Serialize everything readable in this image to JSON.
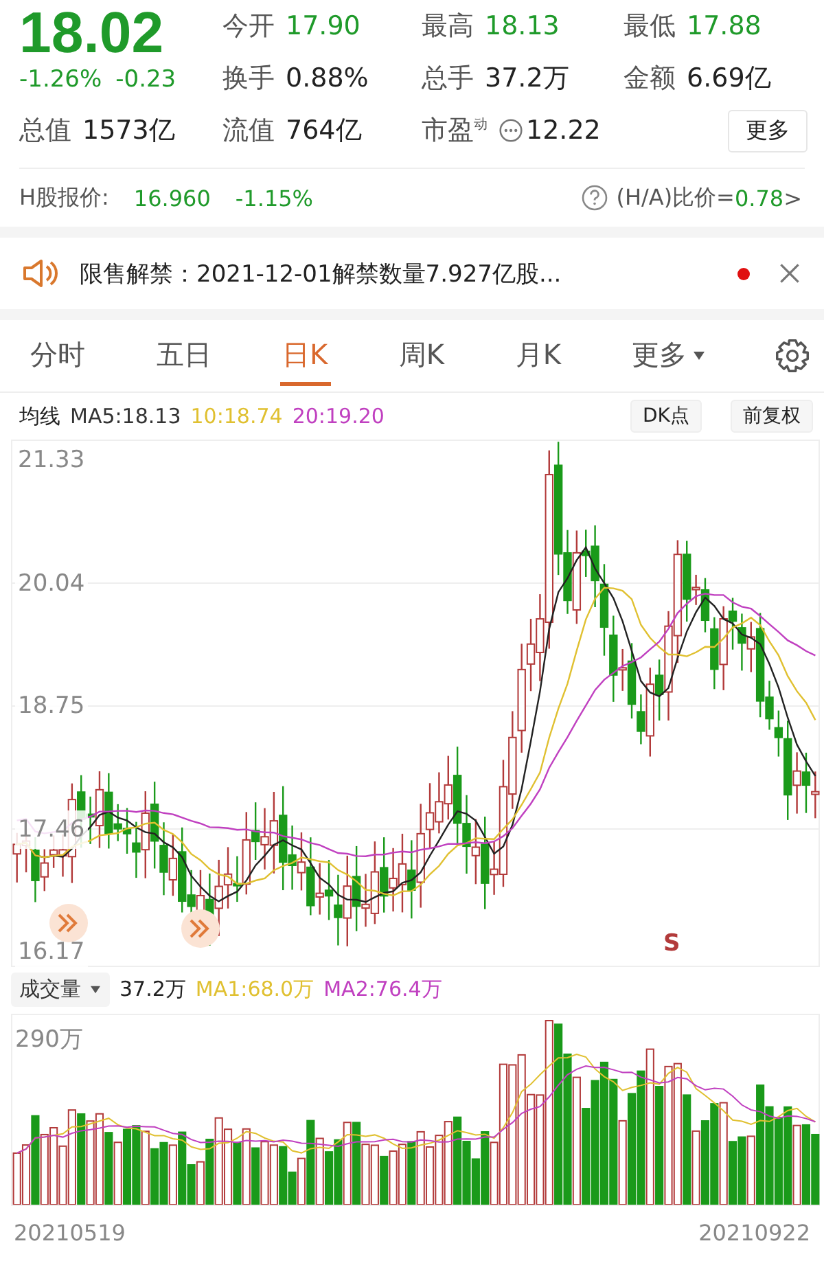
{
  "quote": {
    "price": "18.02",
    "change_pct": "-1.26%",
    "change": "-0.23",
    "color": "#1f9a2a"
  },
  "stats": [
    {
      "label": "今开",
      "value": "17.90",
      "color": "#1f9a2a",
      "kind": "plain"
    },
    {
      "label": "最高",
      "value": "18.13",
      "color": "#1f9a2a",
      "kind": "plain"
    },
    {
      "label": "最低",
      "value": "17.88",
      "color": "#1f9a2a",
      "kind": "plain"
    },
    {
      "label": "换手",
      "value": "0.88%",
      "color": "#222222",
      "kind": "plain"
    },
    {
      "label": "总手",
      "value": "37.2万",
      "color": "#222222",
      "kind": "plain"
    },
    {
      "label": "金额",
      "value": "6.69亿",
      "color": "#222222",
      "kind": "plain"
    },
    {
      "label": "总值",
      "value": "1573亿",
      "color": "#222222",
      "kind": "plain"
    },
    {
      "label": "流值",
      "value": "764亿",
      "color": "#222222",
      "kind": "plain"
    },
    {
      "label": "市盈$^{动}$",
      "value": "12.22",
      "color": "#222222",
      "kind": "with_icon"
    }
  ],
  "more_button": "更多",
  "h_share": {
    "label": "H股报价:",
    "price": "16.960",
    "change": "-1.15%",
    "ratio_label": "(H/A)比价=",
    "ratio_value": "0.78",
    "arrow": ">"
  },
  "notice": {
    "text": "限售解禁：2021-12-01解禁数量7.927亿股...",
    "unread": true
  },
  "tabs": [
    {
      "label": "分时",
      "selected": false,
      "kind": "plain"
    },
    {
      "label": "五日",
      "selected": false,
      "kind": "plain"
    },
    {
      "label": "日K",
      "selected": true,
      "kind": "plain"
    },
    {
      "label": "周K",
      "selected": false,
      "kind": "plain"
    },
    {
      "label": "月K",
      "selected": false,
      "kind": "plain"
    },
    {
      "label": "更多",
      "selected": false,
      "kind": "dropdown"
    }
  ],
  "ma_legend": {
    "title": "均线",
    "items": [
      {
        "text": "MA5:18.13",
        "color": "#333333"
      },
      {
        "text": "10:18.74",
        "color": "#e0c030"
      },
      {
        "text": "20:19.20",
        "color": "#c040c0"
      }
    ],
    "buttons": [
      "DK点",
      "前复权"
    ]
  },
  "price_chart": {
    "y_labels": [
      "21.33",
      "20.04",
      "18.75",
      "17.46",
      "16.17"
    ],
    "signal": "S"
  },
  "volume": {
    "selector": "成交量",
    "value": "37.2万",
    "items": [
      {
        "text": "MA1:68.0万",
        "color": "#e0c030"
      },
      {
        "text": "MA2:76.4万",
        "color": "#c040c0"
      }
    ],
    "y_label": "290万",
    "dates": [
      "20210519",
      "20210922"
    ]
  }
}
